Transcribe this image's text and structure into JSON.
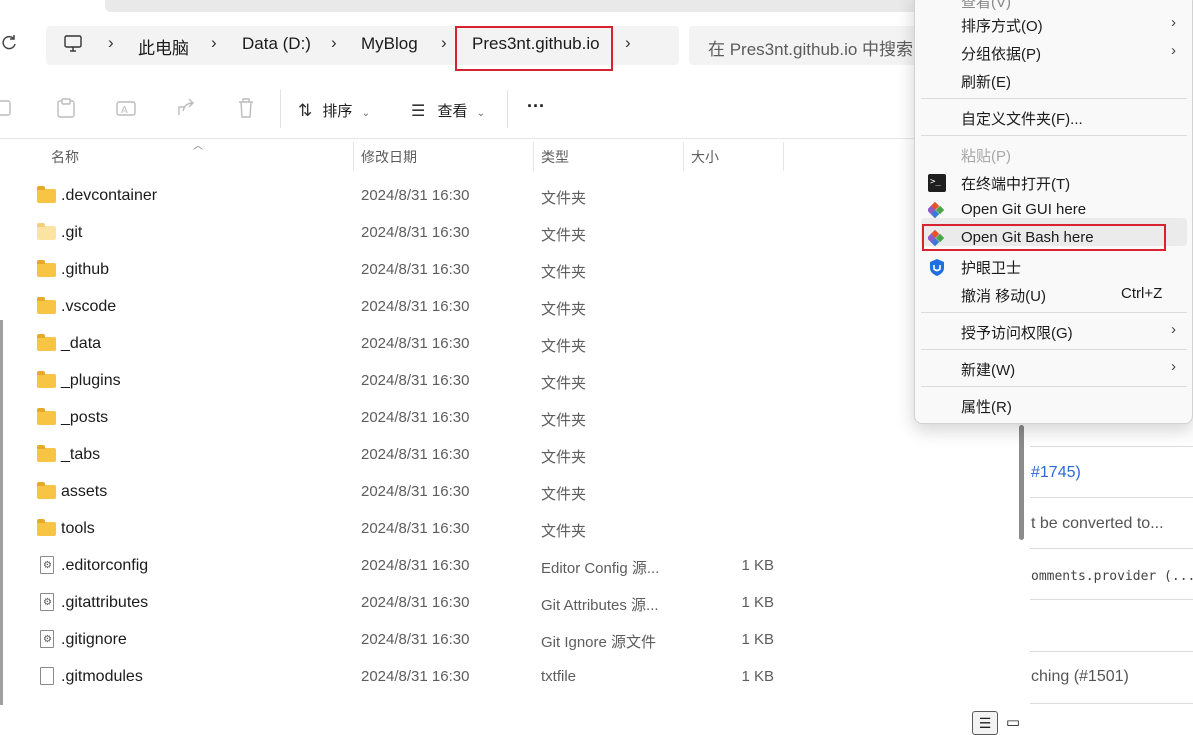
{
  "breadcrumb": {
    "items": [
      "此电脑",
      "Data (D:)",
      "MyBlog",
      "Pres3nt.github.io"
    ]
  },
  "search": {
    "placeholder": "在 Pres3nt.github.io 中搜索"
  },
  "toolbar": {
    "sort_label": "排序",
    "view_label": "查看",
    "more_label": "···"
  },
  "columns": {
    "name": "名称",
    "date": "修改日期",
    "type": "类型",
    "size": "大小"
  },
  "files": [
    {
      "name": ".devcontainer",
      "date": "2024/8/31 16:30",
      "type": "文件夹",
      "size": "",
      "kind": "folder"
    },
    {
      "name": ".git",
      "date": "2024/8/31 16:30",
      "type": "文件夹",
      "size": "",
      "kind": "folder-hidden"
    },
    {
      "name": ".github",
      "date": "2024/8/31 16:30",
      "type": "文件夹",
      "size": "",
      "kind": "folder"
    },
    {
      "name": ".vscode",
      "date": "2024/8/31 16:30",
      "type": "文件夹",
      "size": "",
      "kind": "folder"
    },
    {
      "name": "_data",
      "date": "2024/8/31 16:30",
      "type": "文件夹",
      "size": "",
      "kind": "folder"
    },
    {
      "name": "_plugins",
      "date": "2024/8/31 16:30",
      "type": "文件夹",
      "size": "",
      "kind": "folder"
    },
    {
      "name": "_posts",
      "date": "2024/8/31 16:30",
      "type": "文件夹",
      "size": "",
      "kind": "folder"
    },
    {
      "name": "_tabs",
      "date": "2024/8/31 16:30",
      "type": "文件夹",
      "size": "",
      "kind": "folder"
    },
    {
      "name": "assets",
      "date": "2024/8/31 16:30",
      "type": "文件夹",
      "size": "",
      "kind": "folder"
    },
    {
      "name": "tools",
      "date": "2024/8/31 16:30",
      "type": "文件夹",
      "size": "",
      "kind": "folder"
    },
    {
      "name": ".editorconfig",
      "date": "2024/8/31 16:30",
      "type": "Editor Config 源...",
      "size": "1 KB",
      "kind": "config"
    },
    {
      "name": ".gitattributes",
      "date": "2024/8/31 16:30",
      "type": "Git Attributes 源...",
      "size": "1 KB",
      "kind": "config"
    },
    {
      "name": ".gitignore",
      "date": "2024/8/31 16:30",
      "type": "Git Ignore 源文件",
      "size": "1 KB",
      "kind": "config"
    },
    {
      "name": ".gitmodules",
      "date": "2024/8/31 16:30",
      "type": "txtfile",
      "size": "1 KB",
      "kind": "file"
    }
  ],
  "context_menu": {
    "items": [
      {
        "label": "排序方式(O)",
        "submenu": true
      },
      {
        "label": "分组依据(P)",
        "submenu": true
      },
      {
        "label": "刷新(E)"
      },
      {
        "label": "自定义文件夹(F)..."
      },
      {
        "label": "粘贴(P)",
        "disabled": true
      },
      {
        "label": "在终端中打开(T)",
        "icon": "terminal-icon"
      },
      {
        "label": "Open Git GUI here",
        "icon": "git-icon"
      },
      {
        "label": "Open Git Bash here",
        "icon": "git-icon"
      },
      {
        "label": "护眼卫士",
        "icon": "shield-icon"
      },
      {
        "label": "撤消 移动(U)",
        "shortcut": "Ctrl+Z"
      },
      {
        "label": "授予访问权限(G)",
        "submenu": true
      },
      {
        "label": "新建(W)",
        "submenu": true
      },
      {
        "label": "属性(R)"
      }
    ]
  },
  "background_page": {
    "lines": [
      "#1745)",
      "t be converted to...",
      "omments.provider (...",
      "ching (#1501)"
    ]
  },
  "colors": {
    "highlight_border": "#d6232f",
    "folder": "#f7c443",
    "link": "#2b6ad8"
  }
}
